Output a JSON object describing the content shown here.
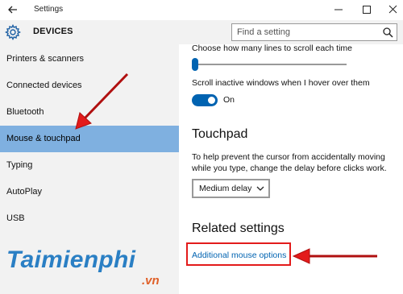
{
  "window": {
    "title": "Settings",
    "controls": {
      "minimize": "minimize-icon",
      "maximize": "maximize-icon",
      "close": "close-icon"
    }
  },
  "header": {
    "title": "DEVICES",
    "icon": "gear-icon",
    "search": {
      "placeholder": "Find a setting",
      "value": ""
    }
  },
  "sidebar": {
    "items": [
      {
        "label": "Printers & scanners",
        "selected": false
      },
      {
        "label": "Connected devices",
        "selected": false
      },
      {
        "label": "Bluetooth",
        "selected": false
      },
      {
        "label": "Mouse & touchpad",
        "selected": true
      },
      {
        "label": "Typing",
        "selected": false
      },
      {
        "label": "AutoPlay",
        "selected": false
      },
      {
        "label": "USB",
        "selected": false
      }
    ],
    "selected_color": "#7fb0e0"
  },
  "main": {
    "scroll_lines_label": "Choose how many lines to scroll each time",
    "scroll_lines_slider_level": 0.0,
    "scroll_inactive_label": "Scroll inactive windows when I hover over them",
    "scroll_inactive_toggle": {
      "state": "On",
      "on": true
    },
    "touchpad": {
      "heading": "Touchpad",
      "description_line1": "To help prevent the cursor from accidentally moving",
      "description_line2": "while you type, change the delay before clicks work.",
      "delay_select": {
        "selected": "Medium delay"
      }
    },
    "related": {
      "heading": "Related settings",
      "link": "Additional mouse options"
    }
  },
  "colors": {
    "accent": "#0063b1",
    "annotation_red": "#e31b1b",
    "watermark_blue": "#2a7fc4",
    "watermark_orange": "#e0612a"
  },
  "watermark": {
    "brand": "Taimienphi",
    "suffix": ".vn"
  }
}
